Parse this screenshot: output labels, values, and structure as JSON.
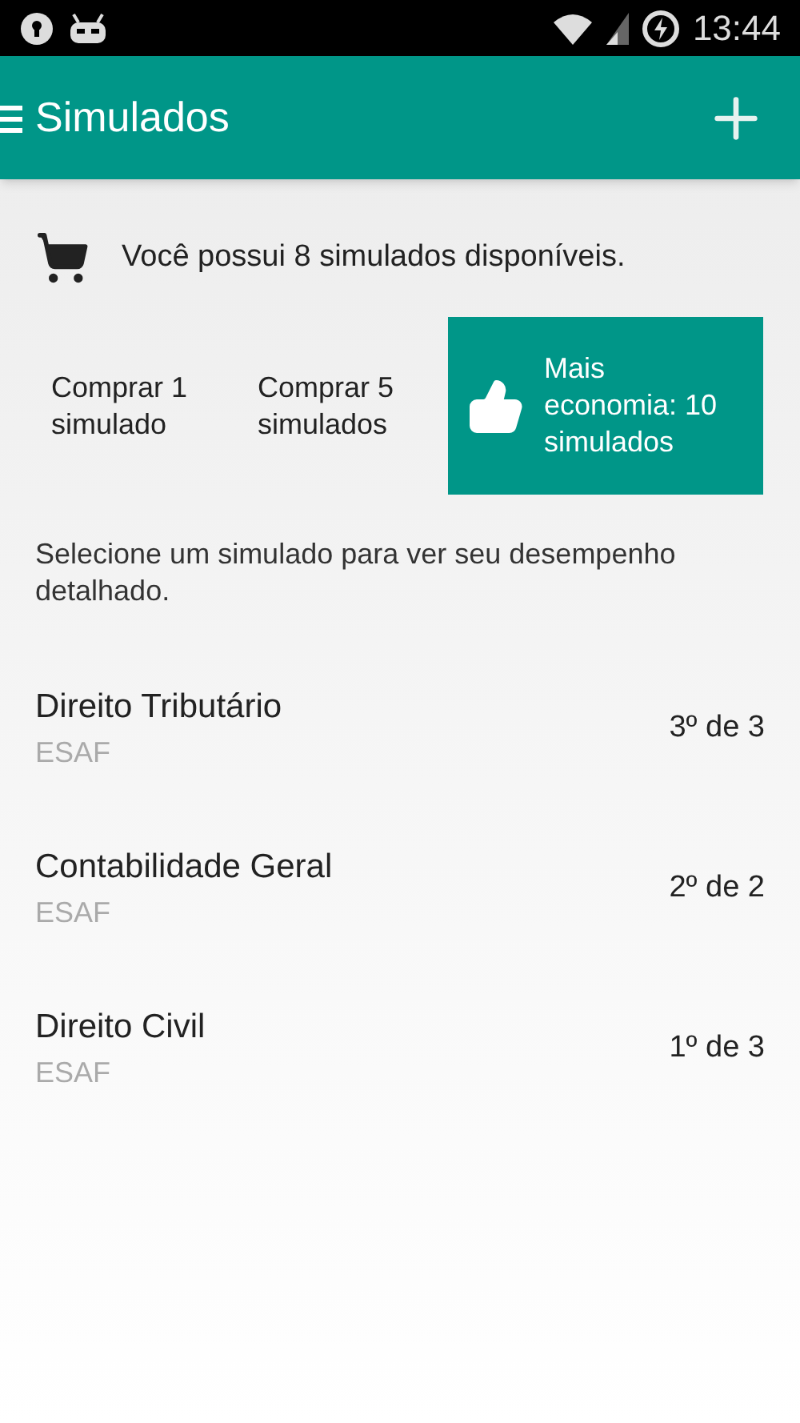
{
  "status_bar": {
    "time": "13:44"
  },
  "app_bar": {
    "title": "Simulados"
  },
  "credits": {
    "text": "Você possui 8 simulados disponíveis."
  },
  "purchase_options": [
    {
      "kind": "plain",
      "label": "Comprar 1 simulado"
    },
    {
      "kind": "plain",
      "label": "Comprar 5 simulados"
    },
    {
      "kind": "featured",
      "label": "Mais economia: 10 simulados"
    }
  ],
  "instructions": "Selecione um simulado para ver seu desempenho detalhado.",
  "exams": [
    {
      "title": "Direito Tributário",
      "board": "ESAF",
      "attempts": "3º de 3"
    },
    {
      "title": "Contabilidade Geral",
      "board": "ESAF",
      "attempts": "2º de 2"
    },
    {
      "title": "Direito Civil",
      "board": "ESAF",
      "attempts": "1º de 3"
    }
  ]
}
